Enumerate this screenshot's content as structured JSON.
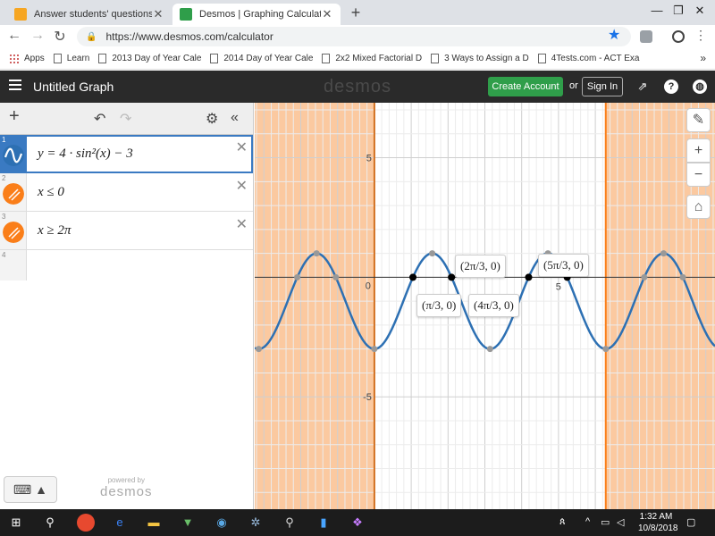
{
  "browser": {
    "tabs": [
      {
        "title": "Answer students' questions and i",
        "close": "✕"
      },
      {
        "title": "Desmos | Graphing Calculator",
        "close": "✕"
      }
    ],
    "new_tab": "+",
    "url": "https://www.desmos.com/calculator",
    "bookmarks": [
      {
        "label": "Apps",
        "icon": "apps-grid-icon"
      },
      {
        "label": "Learn",
        "icon": "page-icon"
      },
      {
        "label": "2013 Day of Year Cale",
        "icon": "page-icon"
      },
      {
        "label": "2014 Day of Year Cale",
        "icon": "page-icon"
      },
      {
        "label": "2x2 Mixed Factorial D",
        "icon": "page-icon"
      },
      {
        "label": "3 Ways to Assign a D",
        "icon": "page-icon"
      },
      {
        "label": "4Tests.com - ACT Exa",
        "icon": "page-icon"
      }
    ],
    "more": "»"
  },
  "desmos": {
    "graph_title": "Untitled Graph",
    "logo": "desmos",
    "create_account": "Create Account",
    "or": "or",
    "sign_in": "Sign In",
    "expressions": [
      {
        "num": "1",
        "latex": "y = 4 · sin²(x) − 3",
        "color": "#2d70b3"
      },
      {
        "num": "2",
        "latex": "x ≤ 0",
        "color": "#fa7e19"
      },
      {
        "num": "3",
        "latex": "x ≥ 2π",
        "color": "#fa7e19"
      }
    ],
    "blank_num": "4",
    "powered_small": "powered by",
    "powered_brand": "desmos",
    "graph": {
      "axis_labels": {
        "y_pos": "5",
        "y_neg": "-5",
        "x_origin": "0",
        "x_pos": "5"
      },
      "point_labels": [
        "(π/3, 0)",
        "(2π/3, 0)",
        "(4π/3, 0)",
        "(5π/3, 0)"
      ],
      "shade_color": "#fbc9a0",
      "curve_color": "#2d70b3"
    }
  },
  "chart_data": {
    "type": "line",
    "function": "y = 4 · sin²(x) − 3",
    "xlim": [
      -3.25,
      9.25
    ],
    "ylim": [
      -9.7,
      7.3
    ],
    "shaded_regions": [
      "x ≤ 0",
      "x ≥ 2π"
    ],
    "labeled_points": [
      {
        "label": "(π/3, 0)",
        "x": 1.0472,
        "y": 0
      },
      {
        "label": "(2π/3, 0)",
        "x": 2.0944,
        "y": 0
      },
      {
        "label": "(4π/3, 0)",
        "x": 4.1888,
        "y": 0
      },
      {
        "label": "(5π/3, 0)",
        "x": 5.236,
        "y": 0
      }
    ],
    "grid": true
  },
  "taskbar": {
    "time": "1:32 AM",
    "date": "10/8/2018"
  }
}
